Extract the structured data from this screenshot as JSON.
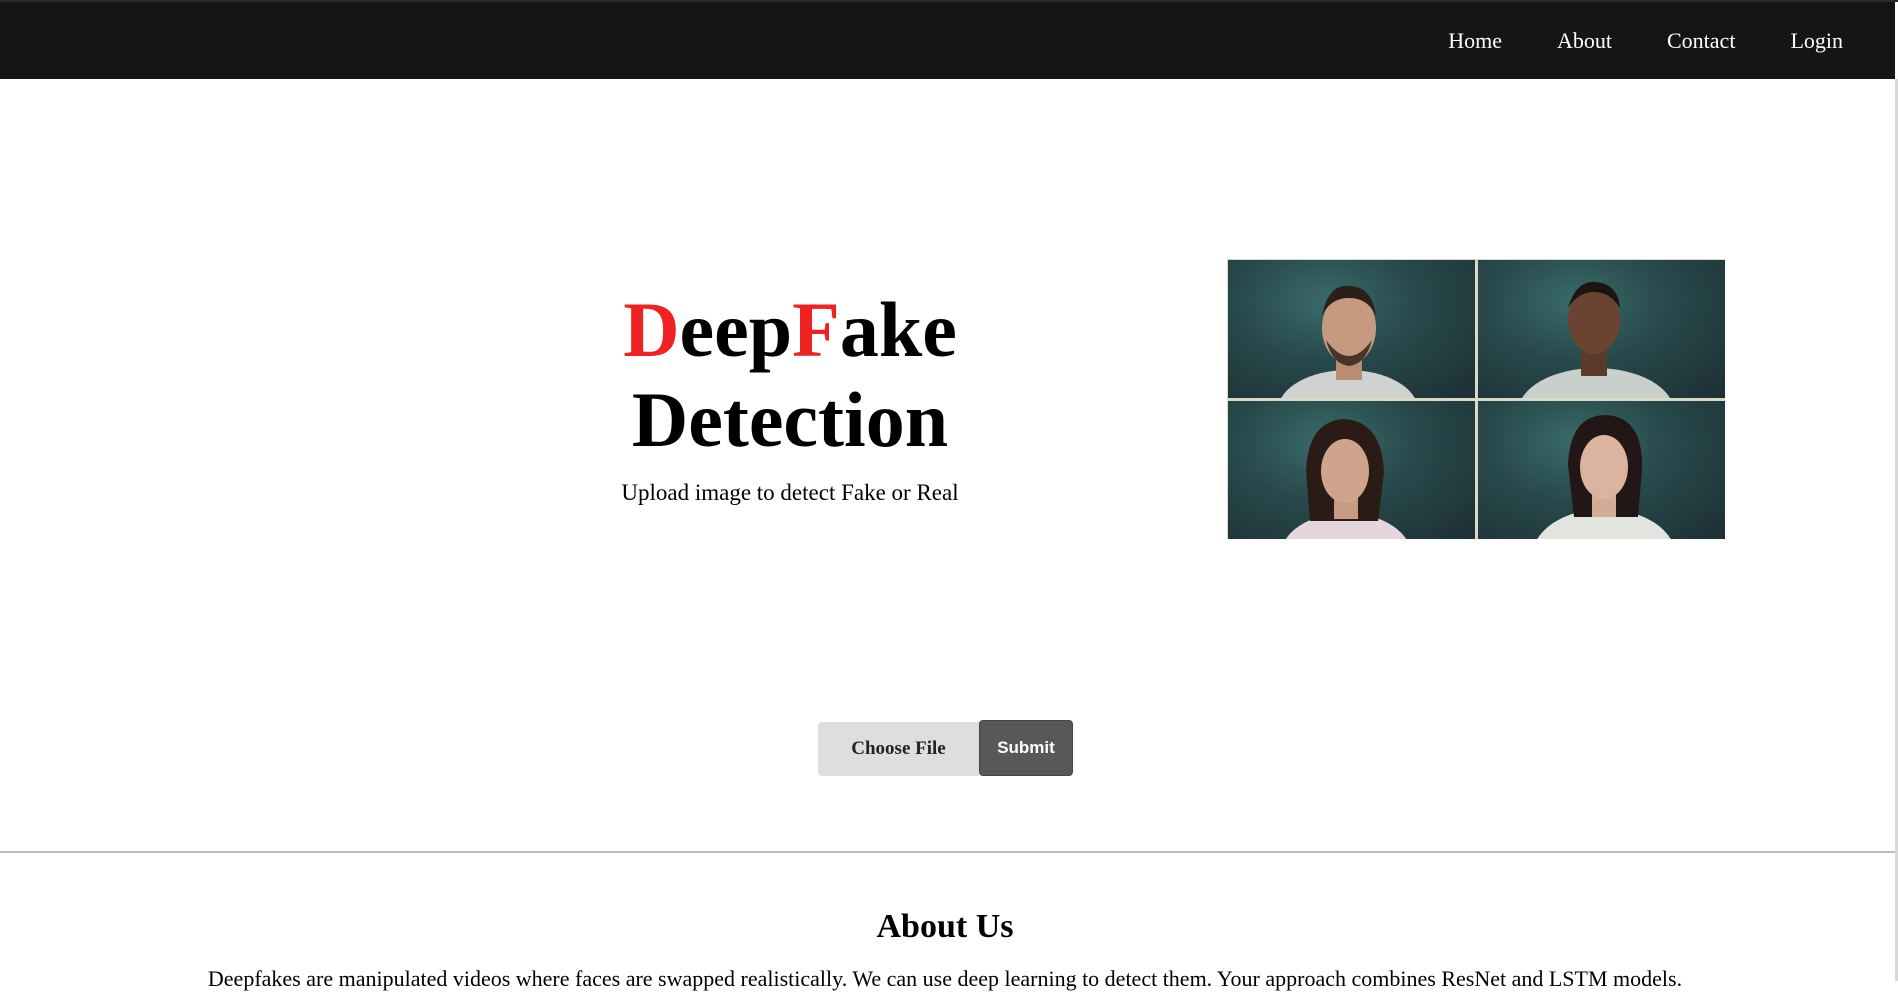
{
  "nav": {
    "links": [
      "Home",
      "About",
      "Contact",
      "Login"
    ]
  },
  "hero": {
    "title_d": "D",
    "title_eep": "eep",
    "title_f": "F",
    "title_ake": "ake",
    "title_line2": "Detection",
    "subtitle": "Upload image to detect Fake or Real",
    "accent_color": "#ef2222"
  },
  "upload": {
    "choose_file_label": "Choose File",
    "submit_label": "Submit"
  },
  "about": {
    "heading": "About Us",
    "text": "Deepfakes are manipulated videos where faces are swapped realistically. We can use deep learning to detect them. Your approach combines ResNet and LSTM models."
  },
  "colors": {
    "navbar_bg": "#151517",
    "submit_bg": "#585858",
    "file_button_bg": "#dedede"
  }
}
